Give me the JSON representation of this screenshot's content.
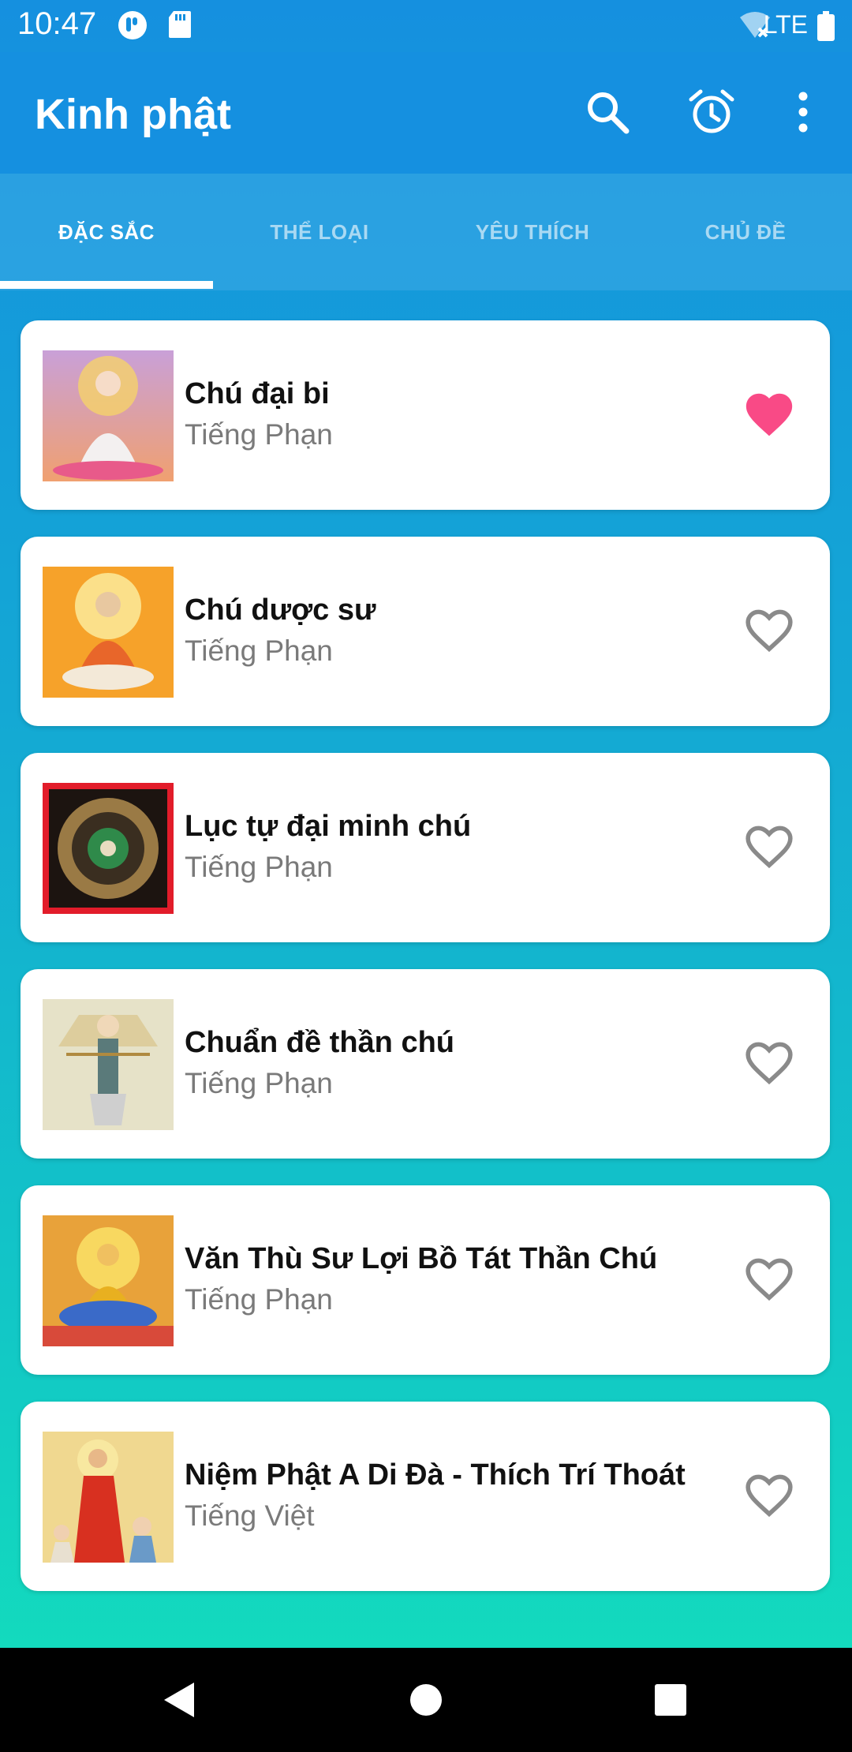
{
  "status_bar": {
    "time": "10:47",
    "network": "LTE"
  },
  "app_bar": {
    "title": "Kinh phật",
    "actions": [
      "search-icon",
      "alarm-icon",
      "more-vert-icon"
    ]
  },
  "tabs": [
    {
      "label": "ĐẶC SẮC",
      "active": true
    },
    {
      "label": "THỂ LOẠI",
      "active": false
    },
    {
      "label": "YÊU THÍCH",
      "active": false
    },
    {
      "label": "CHỦ ĐỀ",
      "active": false
    }
  ],
  "items": [
    {
      "name": "Chú đại bi",
      "language": "Tiếng Phạn",
      "favorite": true
    },
    {
      "name": "Chú dược sư",
      "language": "Tiếng Phạn",
      "favorite": false
    },
    {
      "name": "Lục tự đại minh chú",
      "language": "Tiếng Phạn",
      "favorite": false
    },
    {
      "name": "Chuẩn đề thần chú",
      "language": "Tiếng Phạn",
      "favorite": false
    },
    {
      "name": "Văn Thù Sư Lợi Bồ Tát Thần Chú",
      "language": "Tiếng Phạn",
      "favorite": false
    },
    {
      "name": "Niệm Phật A Di Đà - Thích Trí Thoát",
      "language": "Tiếng Việt",
      "favorite": false
    }
  ],
  "colors": {
    "app_bar": "#1590e0",
    "favorite": "#f94a86",
    "heart_outline": "#8a8a8a"
  }
}
